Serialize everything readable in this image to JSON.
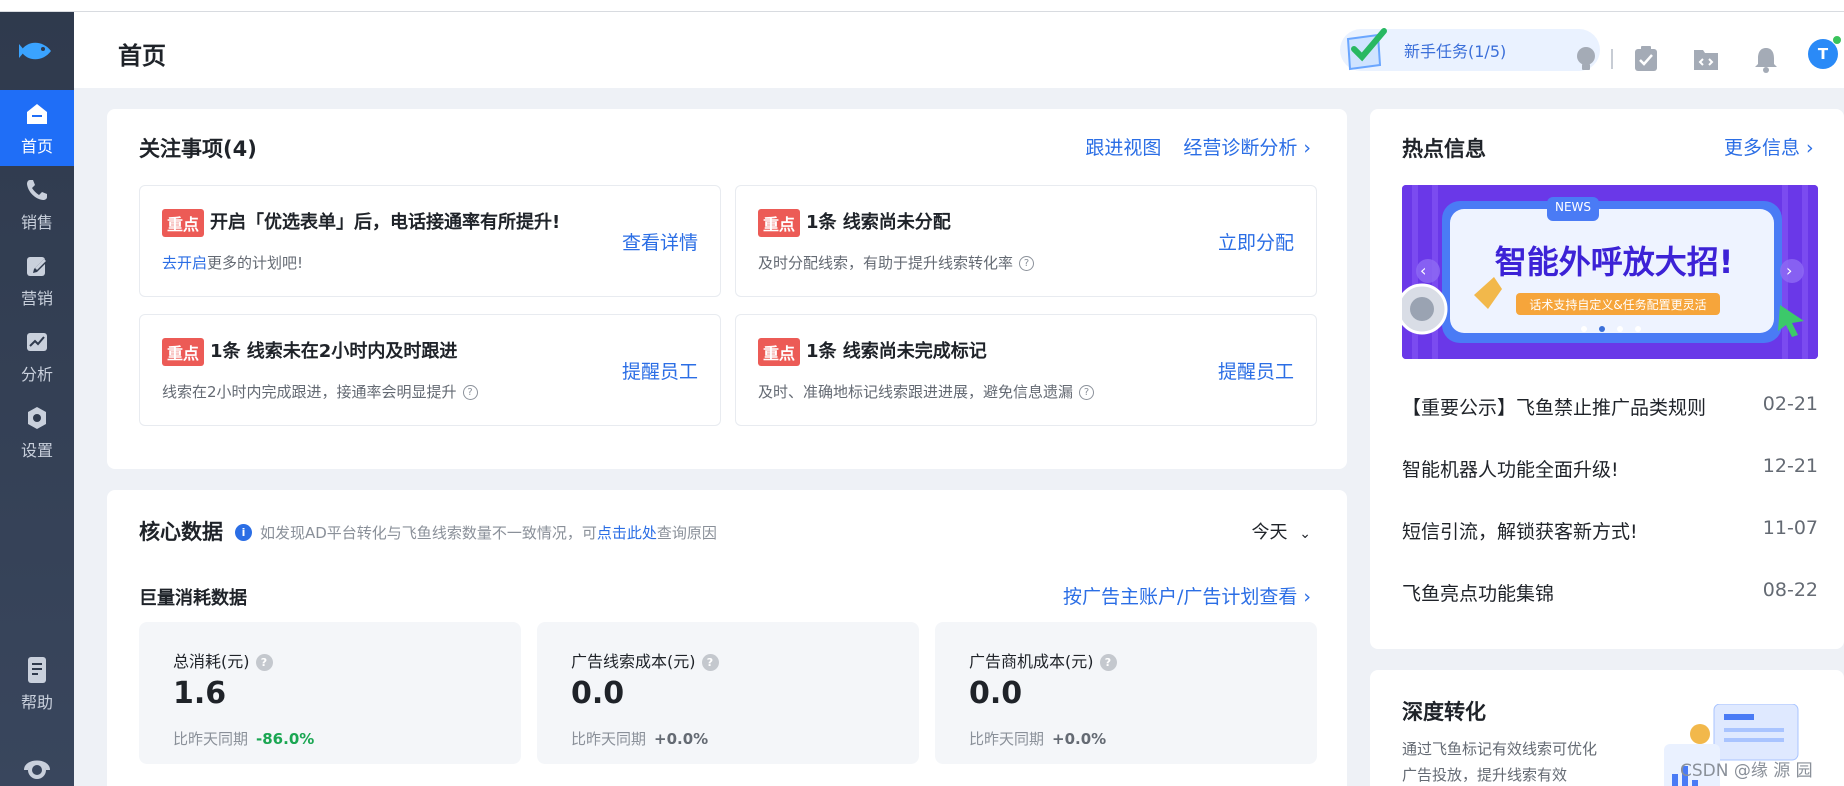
{
  "sidebar": {
    "items": [
      {
        "label": "首页",
        "icon": "home-icon",
        "active": true
      },
      {
        "label": "销售",
        "icon": "phone-icon",
        "active": false
      },
      {
        "label": "营销",
        "icon": "edit-icon",
        "active": false
      },
      {
        "label": "分析",
        "icon": "chart-icon",
        "active": false
      },
      {
        "label": "设置",
        "icon": "settings-icon",
        "active": false
      }
    ],
    "help_label": "帮助"
  },
  "header": {
    "title": "首页",
    "task_label": "新手任务(1/5)"
  },
  "focus": {
    "title": "关注事项(4)",
    "link_follow": "跟进视图",
    "link_diag": "经营诊断分析 ›",
    "items": [
      {
        "tag": "重点",
        "title": "开启「优选表单」后，电话接通率有所提升!",
        "sub_link": "去开启",
        "sub": "更多的计划吧!",
        "action": "查看详情"
      },
      {
        "tag": "重点",
        "title": "1条 线索尚未分配",
        "sub_link": "",
        "sub": "及时分配线索，有助于提升线索转化率",
        "action": "立即分配"
      },
      {
        "tag": "重点",
        "title": "1条 线索未在2小时内及时跟进",
        "sub_link": "",
        "sub": "线索在2小时内完成跟进，接通率会明显提升",
        "action": "提醒员工"
      },
      {
        "tag": "重点",
        "title": "1条 线索尚未完成标记",
        "sub_link": "",
        "sub": "及时、准确地标记线索跟进进展，避免信息遗漏",
        "action": "提醒员工"
      }
    ]
  },
  "core": {
    "title": "核心数据",
    "note_pre": "如发现AD平台转化与飞鱼线索数量不一致情况，可",
    "note_link": "点击此处",
    "note_post": "查询原因",
    "range": "今天",
    "section_title": "巨量消耗数据",
    "section_link": "按广告主账户/广告计划查看 ›",
    "metrics": [
      {
        "label": "总消耗(元)",
        "value": "1.6",
        "compare_label": "比昨天同期",
        "compare_value": "-86.0%",
        "compare_color": "#1aa652"
      },
      {
        "label": "广告线索成本(元)",
        "value": "0.0",
        "compare_label": "比昨天同期",
        "compare_value": "+0.0%",
        "compare_color": "#646a73"
      },
      {
        "label": "广告商机成本(元)",
        "value": "0.0",
        "compare_label": "比昨天同期",
        "compare_value": "+0.0%",
        "compare_color": "#646a73"
      }
    ]
  },
  "hot": {
    "title": "热点信息",
    "more": "更多信息 ›",
    "banner_tag": "NEWS",
    "banner_title": "智能外呼放大招!",
    "banner_sub": "话术支持自定义&任务配置更灵活",
    "news": [
      {
        "title": "【重要公示】飞鱼禁止推广品类规则",
        "date": "02-21"
      },
      {
        "title": "智能机器人功能全面升级!",
        "date": "12-21"
      },
      {
        "title": "短信引流，解锁获客新方式!",
        "date": "11-07"
      },
      {
        "title": "飞鱼亮点功能集锦",
        "date": "08-22"
      }
    ]
  },
  "deep": {
    "title": "深度转化",
    "desc": "通过飞鱼标记有效线索可优化广告投放，提升线索有效"
  },
  "watermark": "CSDN @缘 源 园"
}
